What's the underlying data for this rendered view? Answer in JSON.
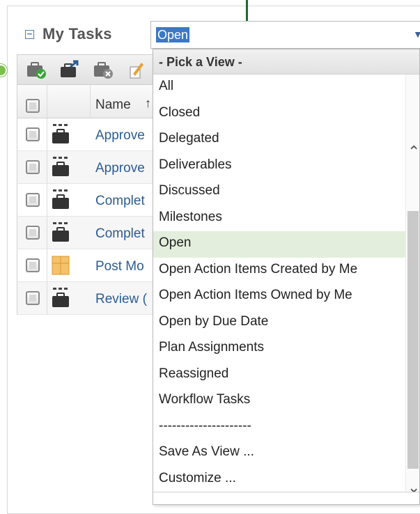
{
  "panel": {
    "title": "My Tasks",
    "collapse_symbol": "−"
  },
  "view_select": {
    "current_value": "Open",
    "arrow_symbol": "▼"
  },
  "toolbar": {
    "icons": [
      "briefcase-check-icon",
      "briefcase-export-icon",
      "briefcase-delete-icon",
      "edit-icon"
    ]
  },
  "grid": {
    "column_name": "Name",
    "sort_symbol": "↑",
    "rows": [
      {
        "name": "Approve",
        "icon": "task-icon"
      },
      {
        "name": "Approve",
        "icon": "task-icon"
      },
      {
        "name": "Complet",
        "icon": "task-icon"
      },
      {
        "name": "Complet",
        "icon": "task-icon"
      },
      {
        "name": "Post Mo",
        "icon": "deliverable-icon"
      },
      {
        "name": "Review (",
        "icon": "task-icon"
      }
    ]
  },
  "dropdown": {
    "header": "- Pick a View -",
    "items": [
      "All",
      "Closed",
      "Delegated",
      "Deliverables",
      "Discussed",
      "Milestones",
      "Open",
      "Open Action Items Created by Me",
      "Open Action Items Owned by Me",
      "Open by Due Date",
      "Plan Assignments",
      "Reassigned",
      "Workflow Tasks",
      "---------------------",
      "Save As View ...",
      "Customize ..."
    ],
    "selected_index": 6,
    "scroll_up_symbol": "⌃",
    "scroll_down_symbol": "⌄"
  },
  "colors": {
    "accent": "#3a78c9",
    "link": "#2b5c93",
    "selected_row": "#e3efdc",
    "callout": "#7cc04b"
  }
}
